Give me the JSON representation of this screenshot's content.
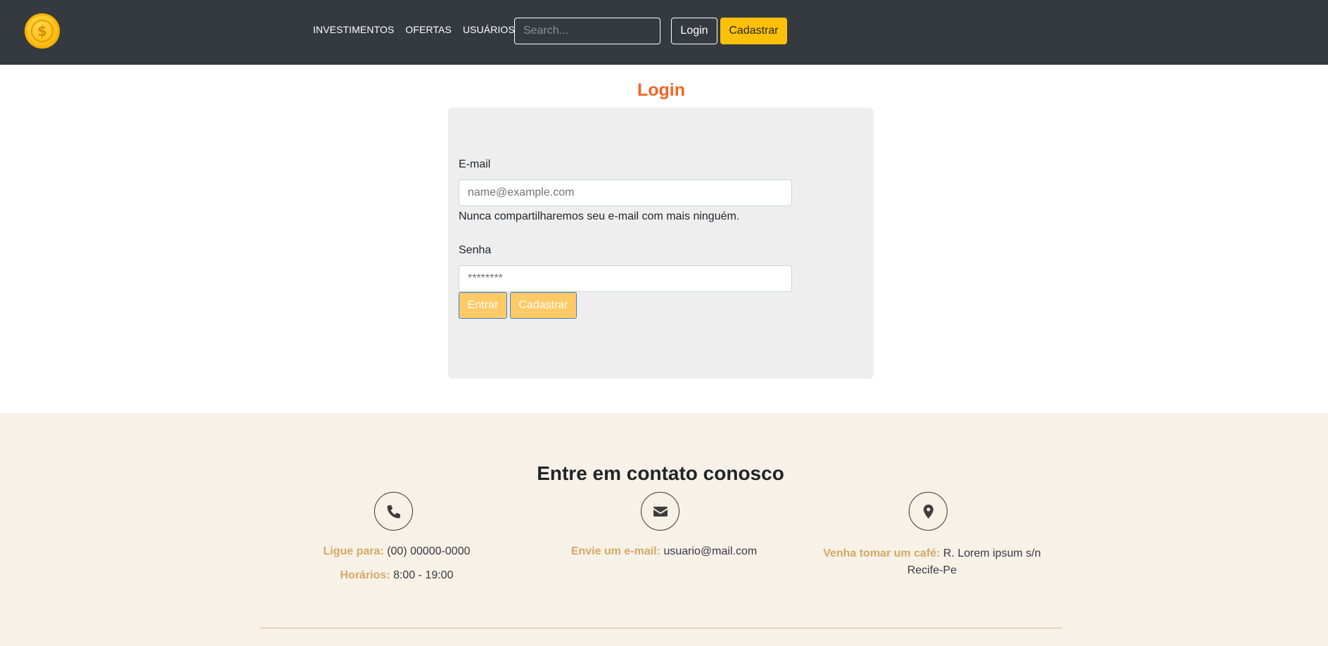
{
  "navbar": {
    "logo_symbol": "$",
    "links": [
      "INVESTIMENTOS",
      "OFERTAS",
      "USUÁRIOS"
    ],
    "search_placeholder": "Search...",
    "login_label": "Login",
    "register_label": "Cadastrar"
  },
  "login": {
    "title": "Login",
    "email_label": "E-mail",
    "email_placeholder": "name@example.com",
    "email_help": "Nunca compartilharemos seu e-mail com mais ninguém.",
    "password_label": "Senha",
    "password_placeholder": "********",
    "submit_label": "Entrar",
    "register_label": "Cadastrar"
  },
  "contact": {
    "title": "Entre em contato conosco",
    "phone_key": "Ligue para:",
    "phone_value": "(00) 00000-0000",
    "hours_key": "Horários:",
    "hours_value": "8:00 - 19:00",
    "email_key": "Envie um e-mail:",
    "email_value": "usuario@mail.com",
    "address_key": "Venha tomar um café:",
    "address_line1": "R. Lorem ipsum s/n",
    "address_line2": "Recife-Pe"
  },
  "colors": {
    "navbar_bg": "#343a40",
    "accent_yellow": "#ffc107",
    "title_orange": "#f26522",
    "contact_key": "#d4a866",
    "contact_bg": "#f8f1e7"
  },
  "icons": [
    "coin-logo-icon",
    "phone-icon",
    "envelope-icon",
    "map-marker-icon"
  ]
}
